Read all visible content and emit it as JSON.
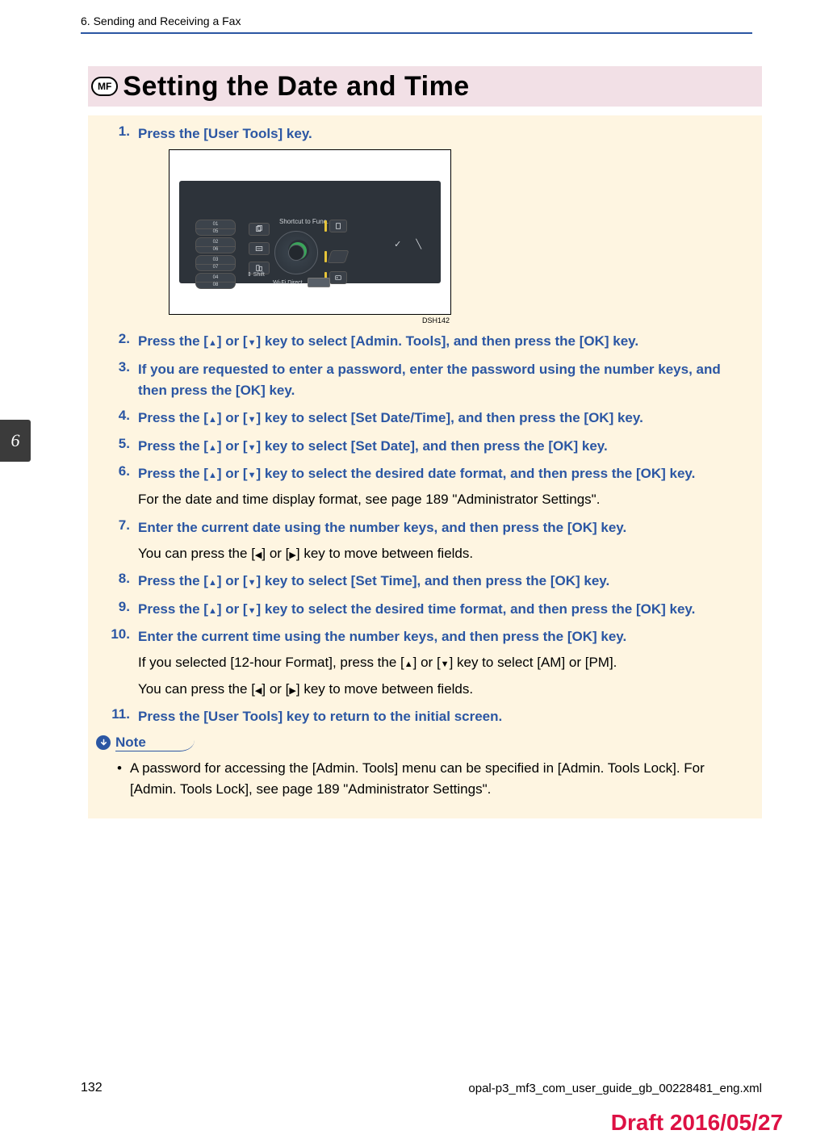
{
  "header": {
    "chapter": "6. Sending and Receiving a Fax"
  },
  "heading": {
    "badge": "MF",
    "title": "Setting the Date and Time"
  },
  "figure": {
    "shortcut_label": "Shortcut to Func.",
    "shift_label": "Shift",
    "wifi_label": "Wi-Fi Direct",
    "leftkeys": [
      [
        "01",
        "05"
      ],
      [
        "02",
        "06"
      ],
      [
        "03",
        "07"
      ],
      [
        "04",
        "08"
      ]
    ],
    "code": "DSH142"
  },
  "steps": [
    {
      "main": "Press the [User Tools] key."
    },
    {
      "main": "Press the [▲] or [▼] key to select [Admin. Tools], and then press the [OK] key."
    },
    {
      "main": "If you are requested to enter a password, enter the password using the number keys, and then press the [OK] key."
    },
    {
      "main": "Press the [▲] or [▼] key to select [Set Date/Time], and then press the [OK] key."
    },
    {
      "main": "Press the [▲] or [▼] key to select [Set Date], and then press the [OK] key."
    },
    {
      "main": "Press the [▲] or [▼] key to select the desired date format, and then press the [OK] key.",
      "subs": [
        "For the date and time display format, see page 189 \"Administrator Settings\"."
      ]
    },
    {
      "main": "Enter the current date using the number keys, and then press the [OK] key.",
      "subs": [
        "You can press the [◀] or [▶] key to move between fields."
      ]
    },
    {
      "main": "Press the [▲] or [▼] key to select [Set Time], and then press the [OK] key."
    },
    {
      "main": "Press the [▲] or [▼] key to select the desired time format, and then press the [OK] key."
    },
    {
      "main": "Enter the current time using the number keys, and then press the [OK] key.",
      "subs": [
        "If you selected [12-hour Format], press the [▲] or [▼] key to select [AM] or [PM].",
        "You can press the [◀] or [▶] key to move between fields."
      ]
    },
    {
      "main": "Press the [User Tools] key to return to the initial screen."
    }
  ],
  "note": {
    "label": "Note",
    "items": [
      "A password for accessing the [Admin. Tools] menu can be specified in [Admin. Tools Lock]. For [Admin. Tools Lock], see page 189 \"Administrator Settings\"."
    ]
  },
  "sideTab": "6",
  "footer": {
    "page": "132",
    "path": "opal-p3_mf3_com_user_guide_gb_00228481_eng.xml",
    "draft": "Draft 2016/05/27"
  }
}
